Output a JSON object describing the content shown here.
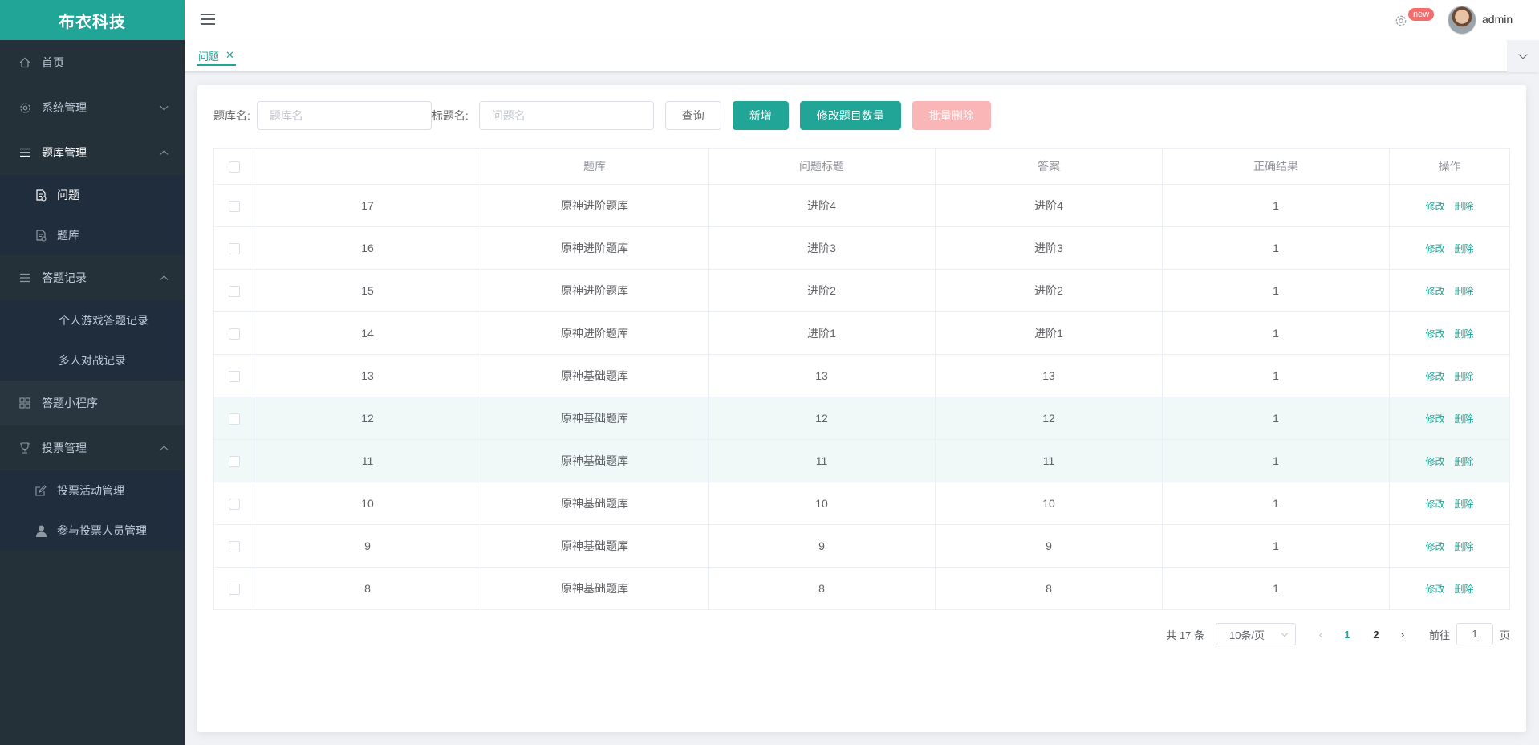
{
  "app": {
    "logo": "布衣科技"
  },
  "sidebar": {
    "items": [
      {
        "label": "首页",
        "icon": "home-icon"
      },
      {
        "label": "系统管理",
        "icon": "gear-icon"
      },
      {
        "label": "题库管理",
        "icon": "list-icon"
      },
      {
        "label": "问题",
        "icon": "document-icon"
      },
      {
        "label": "题库",
        "icon": "document-icon"
      },
      {
        "label": "答题记录",
        "icon": "list-icon"
      },
      {
        "label": "个人游戏答题记录"
      },
      {
        "label": "多人对战记录"
      },
      {
        "label": "答题小程序",
        "icon": "grid-icon"
      },
      {
        "label": "投票管理",
        "icon": "trophy-icon"
      },
      {
        "label": "投票活动管理",
        "icon": "edit-icon"
      },
      {
        "label": "参与投票人员管理",
        "icon": "user-icon"
      }
    ]
  },
  "header": {
    "badge": "new",
    "username": "admin"
  },
  "tags": {
    "active": "问题"
  },
  "search": {
    "bank_label": "题库名:",
    "bank_placeholder": "题库名",
    "title_label": "标题名:",
    "title_placeholder": "问题名",
    "query_btn": "查询",
    "add_btn": "新增",
    "edit_count_btn": "修改题目数量",
    "batch_delete_btn": "批量删除"
  },
  "table": {
    "columns": [
      "",
      "题库",
      "问题标题",
      "答案",
      "正确结果",
      "操作"
    ],
    "edit_label": "修改",
    "delete_label": "删除",
    "rows": [
      {
        "id": "17",
        "bank": "原神进阶题库",
        "title": "进阶4",
        "answer": "进阶4",
        "result": "1"
      },
      {
        "id": "16",
        "bank": "原神进阶题库",
        "title": "进阶3",
        "answer": "进阶3",
        "result": "1"
      },
      {
        "id": "15",
        "bank": "原神进阶题库",
        "title": "进阶2",
        "answer": "进阶2",
        "result": "1"
      },
      {
        "id": "14",
        "bank": "原神进阶题库",
        "title": "进阶1",
        "answer": "进阶1",
        "result": "1"
      },
      {
        "id": "13",
        "bank": "原神基础题库",
        "title": "13",
        "answer": "13",
        "result": "1"
      },
      {
        "id": "12",
        "bank": "原神基础题库",
        "title": "12",
        "answer": "12",
        "result": "1"
      },
      {
        "id": "11",
        "bank": "原神基础题库",
        "title": "11",
        "answer": "11",
        "result": "1"
      },
      {
        "id": "10",
        "bank": "原神基础题库",
        "title": "10",
        "answer": "10",
        "result": "1"
      },
      {
        "id": "9",
        "bank": "原神基础题库",
        "title": "9",
        "answer": "9",
        "result": "1"
      },
      {
        "id": "8",
        "bank": "原神基础题库",
        "title": "8",
        "answer": "8",
        "result": "1"
      }
    ]
  },
  "pagination": {
    "total": "共 17 条",
    "page_size": "10条/页",
    "pages": [
      "1",
      "2"
    ],
    "current": "1",
    "goto_label": "前往",
    "goto_value": "1",
    "page_unit": "页"
  },
  "colors": {
    "primary": "#21a597",
    "sidebar": "#253139",
    "danger_disabled": "#fab6b6"
  }
}
